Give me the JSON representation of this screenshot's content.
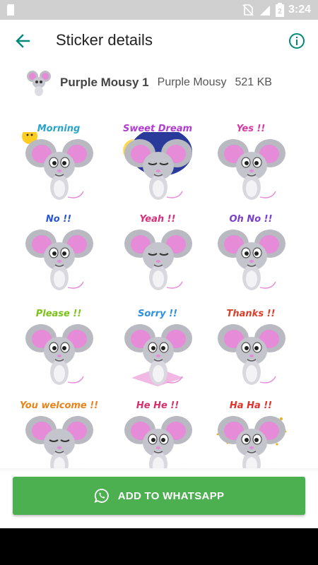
{
  "status_bar": {
    "time": "3:24",
    "battery_digit": "2"
  },
  "toolbar": {
    "title": "Sticker details",
    "back_icon": "arrow-left-icon",
    "info_icon": "info-circle-icon"
  },
  "pack": {
    "name": "Purple Mousy 1",
    "publisher": "Purple Mousy",
    "size": "521 KB"
  },
  "stickers": [
    {
      "caption": "Morning",
      "color": "#29a3c9",
      "pose": "morning"
    },
    {
      "caption": "Sweet Dream",
      "color": "#b23bd0",
      "pose": "sleep"
    },
    {
      "caption": "Yes !!",
      "color": "#d63aa6",
      "pose": "yes"
    },
    {
      "caption": "No !!",
      "color": "#2a55d6",
      "pose": "no"
    },
    {
      "caption": "Yeah !!",
      "color": "#d6307a",
      "pose": "yeah"
    },
    {
      "caption": "Oh No !!",
      "color": "#7b3fd0",
      "pose": "ohno"
    },
    {
      "caption": "Please !!",
      "color": "#7cc21a",
      "pose": "please"
    },
    {
      "caption": "Sorry !!",
      "color": "#2f8fe0",
      "pose": "sorry"
    },
    {
      "caption": "Thanks !!",
      "color": "#d9402b",
      "pose": "thanks"
    },
    {
      "caption": "You welcome !!",
      "color": "#e8841a",
      "pose": "welcome"
    },
    {
      "caption": "He He !!",
      "color": "#d6306a",
      "pose": "hehe"
    },
    {
      "caption": "Ha Ha !!",
      "color": "#e2312b",
      "pose": "haha"
    }
  ],
  "action": {
    "label": "ADD TO WHATSAPP",
    "icon": "whatsapp-icon"
  },
  "colors": {
    "accent_teal": "#00897b",
    "button_green": "#4caf50",
    "status_bar": "#d0d0d0"
  }
}
